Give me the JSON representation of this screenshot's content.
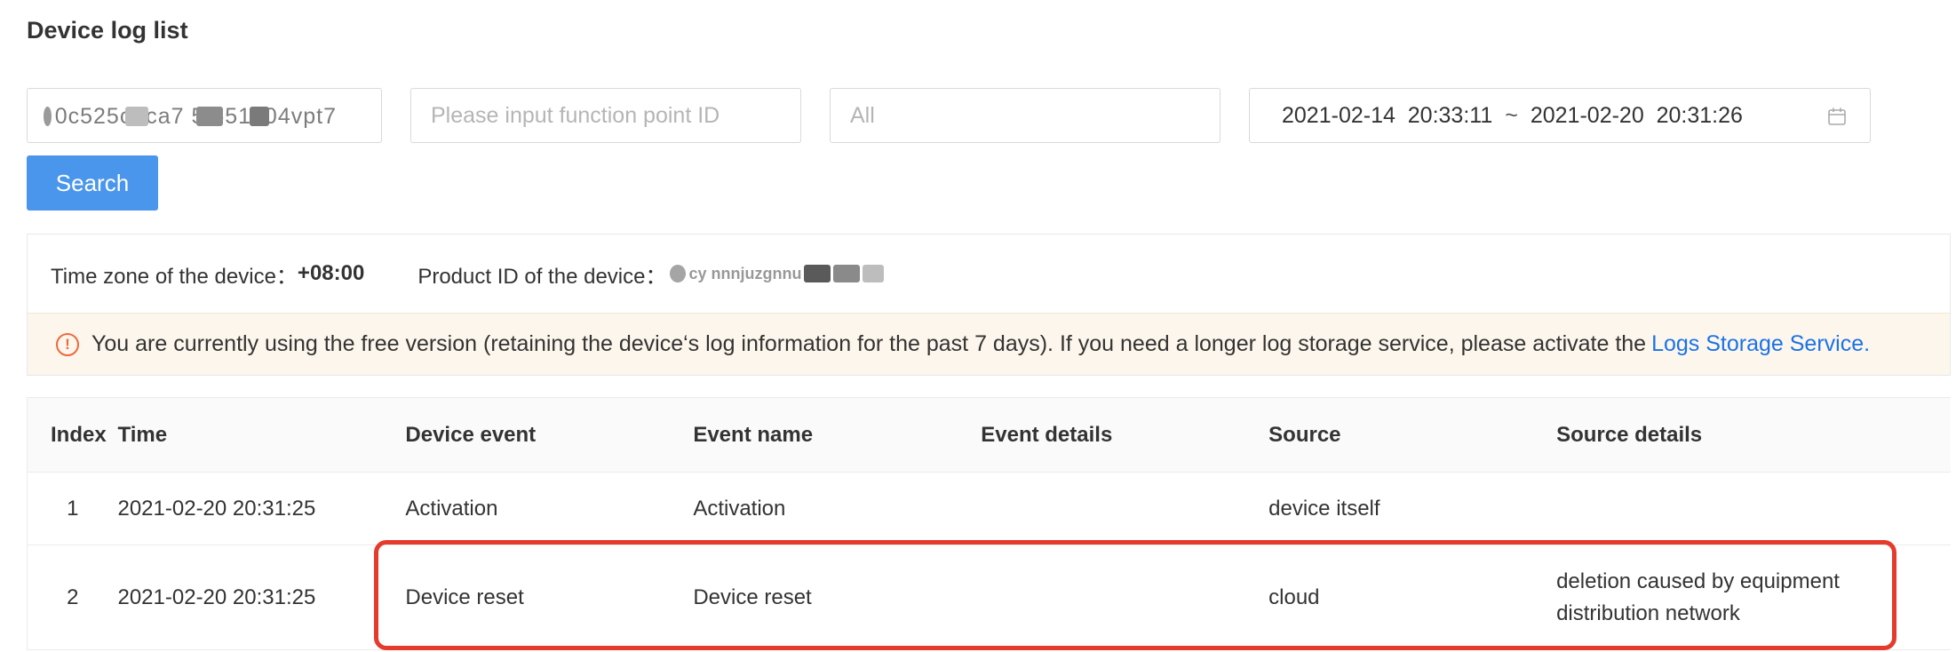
{
  "page_title": "Device log list",
  "filters": {
    "device_id_masked_visible": "0c525c fca7 5t651a04vpt7",
    "function_point_placeholder": "Please input function point ID",
    "event_type_selected": "All",
    "date_start": "2021-02-14  20:33:11",
    "date_separator": "~",
    "date_end": "2021-02-20  20:31:26",
    "calendar_icon": "calendar-icon"
  },
  "search_button_label": "Search",
  "info": {
    "timezone_label": "Time zone of the device：",
    "timezone_value": "+08:00",
    "product_id_label": "Product ID of the device：",
    "product_id_masked_visible": "cy nnnjuzgnnu"
  },
  "notice": {
    "icon": "warning-circle-icon",
    "text": "You are currently using the free version (retaining the device‘s log information for the past 7 days). If you need a longer log storage service, please activate the",
    "link_text": "Logs Storage Service."
  },
  "table": {
    "columns": [
      "Index",
      "Time",
      "Device event",
      "Event name",
      "Event details",
      "Source",
      "Source details"
    ],
    "rows": [
      {
        "index": "1",
        "time": "2021-02-20 20:31:25",
        "device_event": "Activation",
        "event_name": "Activation",
        "event_details": "",
        "source": "device itself",
        "source_details": ""
      },
      {
        "index": "2",
        "time": "2021-02-20 20:31:25",
        "device_event": "Device reset",
        "event_name": "Device reset",
        "event_details": "",
        "source": "cloud",
        "source_details": "deletion caused by equipment distribution network"
      }
    ]
  },
  "colors": {
    "primary": "#4a96ec",
    "link": "#1a73e8",
    "warning": "#ec6a3f",
    "highlight": "#e53a2c",
    "notice_bg": "#fdf6ec"
  }
}
